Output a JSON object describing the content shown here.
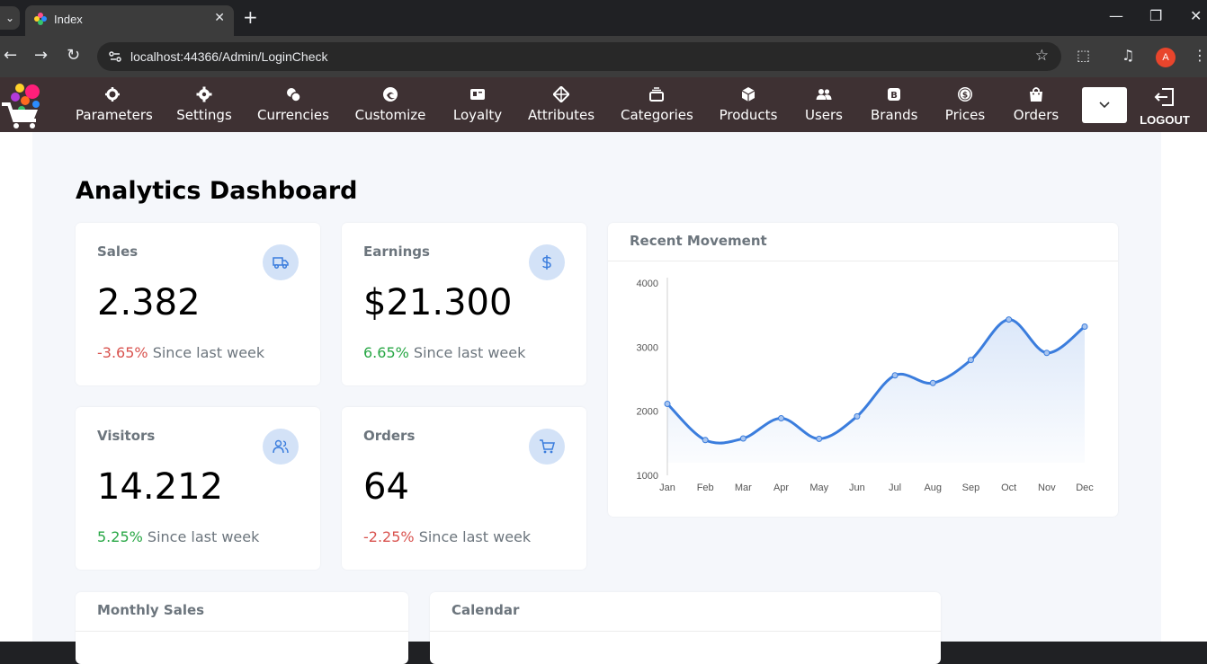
{
  "browser": {
    "tab_title": "Index",
    "url_host": "localhost",
    "url_rest": ":44366/Admin/LoginCheck",
    "avatar_letter": "A"
  },
  "nav": {
    "items": [
      {
        "label": "Parameters",
        "icon": "gear-icon"
      },
      {
        "label": "Settings",
        "icon": "cog-icon"
      },
      {
        "label": "Currencies",
        "icon": "coins-icon"
      },
      {
        "label": "Customize",
        "icon": "edge-icon"
      },
      {
        "label": "Loyalty",
        "icon": "card-icon"
      },
      {
        "label": "Attributes",
        "icon": "diamond-grid-icon"
      },
      {
        "label": "Categories",
        "icon": "layers-icon"
      },
      {
        "label": "Products",
        "icon": "box-icon"
      },
      {
        "label": "Users",
        "icon": "users-icon"
      },
      {
        "label": "Brands",
        "icon": "brand-b-icon"
      },
      {
        "label": "Prices",
        "icon": "dollar-circle-icon"
      },
      {
        "label": "Orders",
        "icon": "shopping-bag-icon"
      }
    ],
    "logout_label": "LOGOUT"
  },
  "page": {
    "title": "Analytics Dashboard"
  },
  "stats": [
    {
      "label": "Sales",
      "value": "2.382",
      "change": "-3.65%",
      "trend": "negative",
      "since": "Since last week",
      "icon": "truck-icon"
    },
    {
      "label": "Earnings",
      "value": "$21.300",
      "change": "6.65%",
      "trend": "positive",
      "since": "Since last week",
      "icon": "dollar-icon"
    },
    {
      "label": "Visitors",
      "value": "14.212",
      "change": "5.25%",
      "trend": "positive",
      "since": "Since last week",
      "icon": "users-icon"
    },
    {
      "label": "Orders",
      "value": "64",
      "change": "-2.25%",
      "trend": "negative",
      "since": "Since last week",
      "icon": "cart-icon"
    }
  ],
  "colors": {
    "accent": "#3b7ddd",
    "negative": "#d9534f",
    "positive": "#28a745",
    "nav_bg": "#3e3133"
  },
  "recent_movement": {
    "title": "Recent Movement",
    "chart_data": {
      "type": "area",
      "categories": [
        "Jan",
        "Feb",
        "Mar",
        "Apr",
        "May",
        "Jun",
        "Jul",
        "Aug",
        "Sep",
        "Oct",
        "Nov",
        "Dec"
      ],
      "values": [
        2115,
        1550,
        1575,
        1890,
        1570,
        1920,
        2560,
        2440,
        2800,
        3430,
        2910,
        3320
      ],
      "ylim": [
        1000,
        4000
      ],
      "yticks": [
        1000,
        2000,
        3000,
        4000
      ],
      "grid": false,
      "color": "#3b7ddd"
    }
  },
  "bottom_cards": {
    "monthly_sales": "Monthly Sales",
    "calendar": "Calendar"
  }
}
